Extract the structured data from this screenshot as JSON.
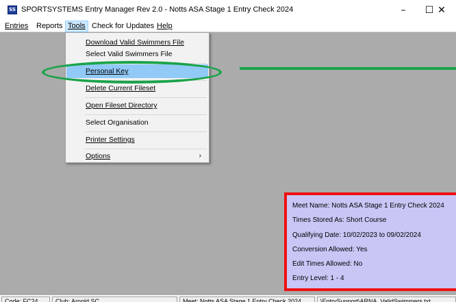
{
  "window": {
    "title": "SPORTSYSTEMS Entry Manager Rev 2.0 - Notts ASA Stage 1 Entry Check 2024",
    "icon": "app-icon",
    "controls": {
      "minimize": "–",
      "maximize": "☐",
      "close": "✕"
    }
  },
  "menubar": {
    "items": [
      "Entries",
      "Reports",
      "Tools",
      "Check for Updates",
      "Help"
    ],
    "open_menu": "Tools"
  },
  "tools_menu": {
    "items": [
      "Download Valid Swimmers File",
      "Select Valid Swimmers File",
      "Personal Key",
      "Delete Current Fileset",
      "Open Fileset Directory",
      "Select Organisation",
      "Printer Settings",
      "Options"
    ],
    "highlighted": "Personal Key",
    "submenu_arrow": "›"
  },
  "info_panel": {
    "lines": [
      "Meet Name: Notts ASA Stage 1 Entry Check 2024",
      "Times Stored As: Short Course",
      "Qualifying Date: 10/02/2023 to 09/02/2024",
      "Conversion Allowed: Yes",
      "Edit Times Allowed: No",
      "Entry Level: 1 - 4"
    ]
  },
  "statusbar": {
    "cells": [
      "Code: FC24",
      "Club: Arnold SC",
      "Meet: Notts ASA Stage 1 Entry Check 2024",
      "\\EntrySupport\\ARNA_ValidSwimmers.txt"
    ]
  },
  "colors": {
    "highlight_oval": "#1aa34a",
    "info_border": "#ee1010",
    "info_bg": "#c8c6f5",
    "menu_highlight": "#91c9f7",
    "workspace": "#ababab"
  }
}
